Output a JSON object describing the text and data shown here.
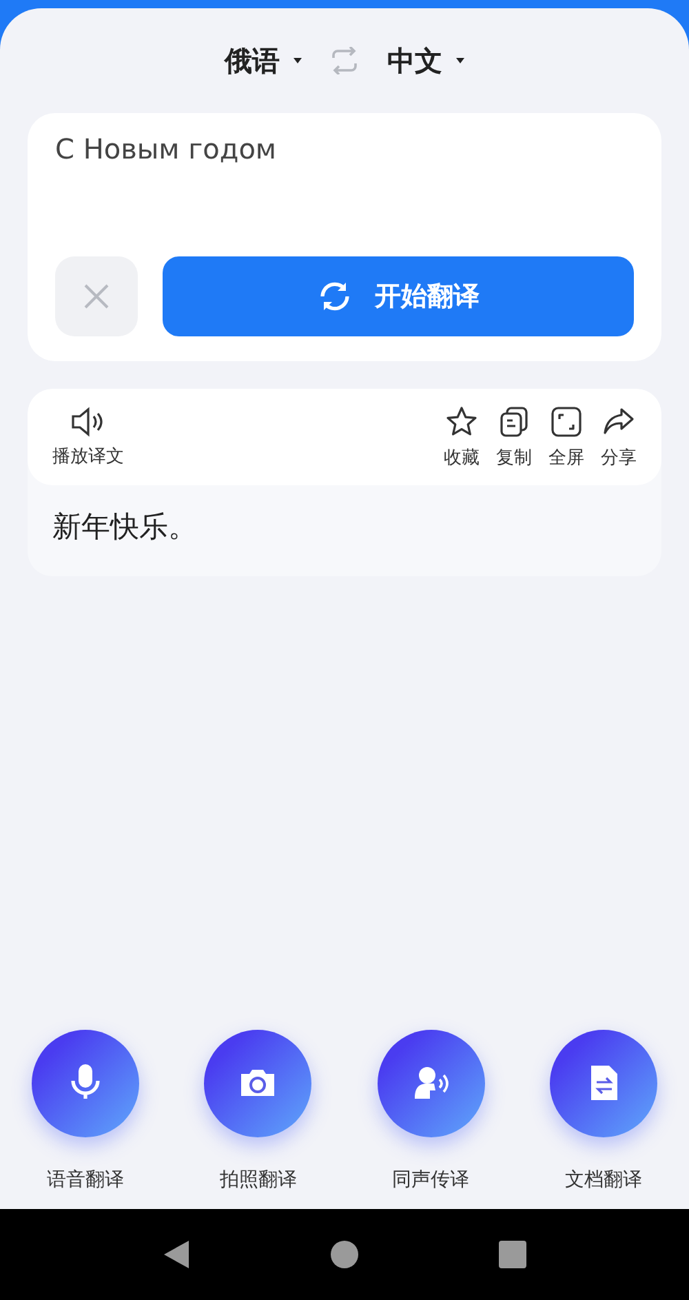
{
  "languages": {
    "source": "俄语",
    "target": "中文"
  },
  "input": {
    "value": "С Новым годом"
  },
  "translate_button": {
    "label": "开始翻译"
  },
  "result": {
    "play": {
      "label": "播放译文"
    },
    "actions": [
      {
        "kind": "star",
        "label": "收藏"
      },
      {
        "kind": "copy",
        "label": "复制"
      },
      {
        "kind": "fullscreen",
        "label": "全屏"
      },
      {
        "kind": "share",
        "label": "分享"
      }
    ],
    "text": "新年快乐。"
  },
  "features": [
    {
      "kind": "mic",
      "label": "语音翻译"
    },
    {
      "kind": "camera",
      "label": "拍照翻译"
    },
    {
      "kind": "speaker",
      "label": "同声传译"
    },
    {
      "kind": "document",
      "label": "文档翻译"
    }
  ]
}
